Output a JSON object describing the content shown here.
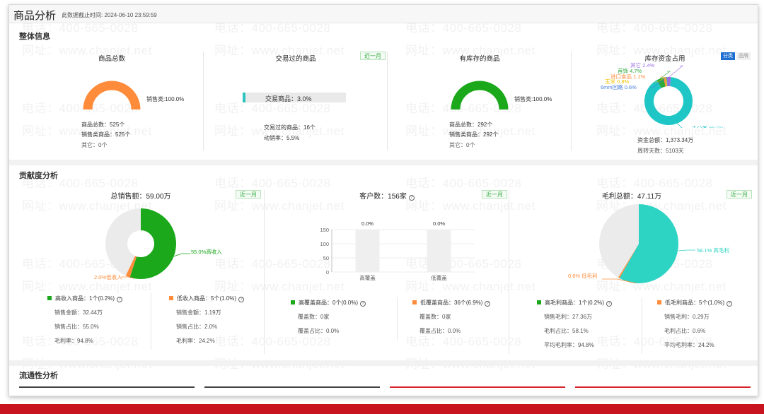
{
  "header": {
    "title": "商品分析",
    "cutoff_label": "此数据截止时间: 2024-06-10 23:59:59"
  },
  "overview": {
    "title": "整体信息",
    "total_goods": {
      "title": "商品总数",
      "legend": "销售类:100.0%",
      "gauge_fraction": 1.0,
      "color": "#ff8c3a",
      "total": "商品总数：525个",
      "sales": "销售类商品：525个",
      "other": "其它：0个"
    },
    "traded_goods": {
      "title": "交易过的商品",
      "badge": "近一月",
      "bar_label": "交易商品：3.0%",
      "bar_fraction": 0.03,
      "traded": "交易过的商品：16个",
      "turnover": "动销率：5.5%"
    },
    "stocked_goods": {
      "title": "有库存的商品",
      "legend": "销售类:100.0%",
      "gauge_fraction": 1.0,
      "color": "#1ba81b",
      "total": "商品总数：292个",
      "sales": "销售类商品：292个",
      "other": "其它：0个"
    },
    "inventory_funds": {
      "title": "库存资金占用",
      "tab_category": "分类",
      "tab_brand": "品牌",
      "chart_data": {
        "type": "pie",
        "slices": [
          {
            "label": "未分类 90.5%",
            "value": 90.5,
            "color": "#1fc6c6"
          },
          {
            "label": "首饰 4.7%",
            "value": 4.7,
            "color": "#2eaa3c"
          },
          {
            "label": "进口食品 1.1%",
            "value": 1.1,
            "color": "#ff8c3a"
          },
          {
            "label": "玉米 0.8%",
            "value": 0.8,
            "color": "#f2c200"
          },
          {
            "label": "6mm回路 0.6%",
            "value": 0.6,
            "color": "#4a7fd9"
          },
          {
            "label": "其它 2.4%",
            "value": 2.4,
            "color": "#9b6fe0"
          }
        ]
      },
      "total": "资金总额：1,373.34万",
      "days": "周转天数：5103天"
    }
  },
  "contribution": {
    "title": "贡献度分析",
    "sales": {
      "title": "总销售额：59.00万",
      "badge": "近一月",
      "chart_data": {
        "type": "pie",
        "slices": [
          {
            "label": "55.0%高收入",
            "value": 55.0,
            "color": "#1ba81b"
          },
          {
            "label": "2.0%低收入",
            "value": 2.0,
            "color": "#ff8c3a"
          },
          {
            "label": "",
            "value": 43.0,
            "color": "#ebebeb"
          }
        ]
      },
      "high": {
        "label": "高收入商品：1个(0.2%)",
        "color": "#1ba81b",
        "amount": "销售金额：32.44万",
        "share": "销售占比：55.0%",
        "margin": "毛利率：94.8%"
      },
      "low": {
        "label": "低收入商品：5个(1.0%)",
        "color": "#ff8c3a",
        "amount": "销售金额：1.19万",
        "share": "销售占比：2.0%",
        "margin": "毛利率：24.2%"
      }
    },
    "customers": {
      "title": "客户数：156家",
      "badge": "近一月",
      "chart_data": {
        "type": "bar",
        "categories": [
          "高覆盖",
          "低覆盖"
        ],
        "values": [
          0,
          0
        ],
        "data_labels": [
          "0.0%",
          "0.0%"
        ],
        "yticks": [
          0,
          50,
          100,
          150
        ],
        "ylim": [
          0,
          150
        ]
      },
      "high": {
        "label": "高覆盖商品：0个(0.0%)",
        "color": "#1ba81b",
        "count": "覆盖数：0家",
        "share": "覆盖占比：0.0%"
      },
      "low": {
        "label": "低覆盖商品：36个(6.9%)",
        "color": "#ff8c3a",
        "count": "覆盖数：0家",
        "share": "覆盖占比：0.0%"
      }
    },
    "gross_profit": {
      "title": "毛利总额：47.11万",
      "badge": "近一月",
      "chart_data": {
        "type": "pie",
        "slices": [
          {
            "label": "58.1% 高毛利",
            "value": 58.1,
            "color": "#2dd4c4"
          },
          {
            "label": "0.6% 低毛利",
            "value": 0.6,
            "color": "#ff8c3a"
          },
          {
            "label": "",
            "value": 41.3,
            "color": "#ebebeb"
          }
        ]
      },
      "high": {
        "label": "高毛利商品：1个(0.2%)",
        "color": "#1ba81b",
        "amount": "销售毛利：27.36万",
        "share": "毛利占比：58.1%",
        "margin": "平均毛利率：94.8%"
      },
      "low": {
        "label": "低毛利商品：5个(1.0%)",
        "color": "#ff8c3a",
        "amount": "销售毛利：0.29万",
        "share": "毛利占比：0.6%",
        "margin": "平均毛利率：24.2%"
      }
    }
  },
  "liquidity": {
    "title": "流通性分析"
  },
  "watermark": {
    "phone": "电话：400-665-0028",
    "site": "网址：www.chanjet.net"
  }
}
